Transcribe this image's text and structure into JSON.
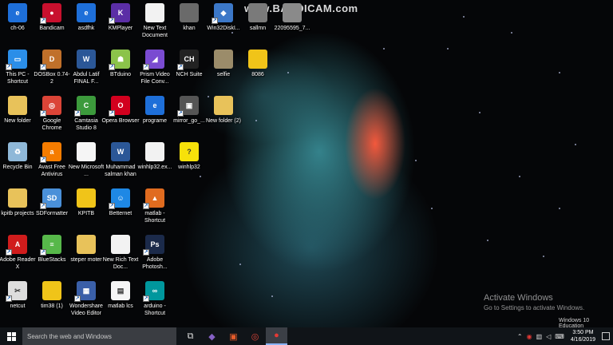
{
  "watermark": "www.BANDICAM.com",
  "desktop_icons": [
    {
      "label": "ch-06",
      "icon": "pdf-edge-icon",
      "color": "#1e6fd9",
      "glyph": "e",
      "col": 0,
      "row": 0
    },
    {
      "label": "Bandicam",
      "icon": "bandicam-icon",
      "color": "#c8102e",
      "glyph": "●",
      "col": 1,
      "row": 0
    },
    {
      "label": "asdfhk",
      "icon": "pdf-edge-icon",
      "color": "#1e6fd9",
      "glyph": "e",
      "col": 2,
      "row": 0
    },
    {
      "label": "KMPlayer",
      "icon": "kmplayer-icon",
      "color": "#5b2ea6",
      "glyph": "K",
      "col": 3,
      "row": 0
    },
    {
      "label": "New Text Document",
      "icon": "text-document-icon",
      "color": "#f2f2f2",
      "glyph": "",
      "col": 4,
      "row": 0
    },
    {
      "label": "khan",
      "icon": "image-file-icon",
      "color": "#6a6a6a",
      "glyph": "",
      "col": 5,
      "row": 0
    },
    {
      "label": "Win32DiskI...",
      "icon": "win32disk-icon",
      "color": "#3c78c8",
      "glyph": "◆",
      "col": 6,
      "row": 0
    },
    {
      "label": "sallmn",
      "icon": "image-file-icon",
      "color": "#7a7a7a",
      "glyph": "",
      "col": 7,
      "row": 0
    },
    {
      "label": "22095595_7...",
      "icon": "image-file-icon",
      "color": "#8a8a8a",
      "glyph": "",
      "col": 8,
      "row": 0
    },
    {
      "label": "This PC - Shortcut",
      "icon": "this-pc-icon",
      "color": "#2b8ee8",
      "glyph": "▭",
      "col": 0,
      "row": 1
    },
    {
      "label": "DOSBox 0.74-2",
      "icon": "dosbox-icon",
      "color": "#c0702a",
      "glyph": "D",
      "col": 1,
      "row": 1
    },
    {
      "label": "Abdul Latif FINAL F...",
      "icon": "word-document-icon",
      "color": "#2b5797",
      "glyph": "W",
      "col": 2,
      "row": 1
    },
    {
      "label": "BTduino",
      "icon": "btduino-icon",
      "color": "#8bc34a",
      "glyph": "☗",
      "col": 3,
      "row": 1
    },
    {
      "label": "Prism Video File Conv...",
      "icon": "prism-video-icon",
      "color": "#7a4bd1",
      "glyph": "◢",
      "col": 4,
      "row": 1
    },
    {
      "label": "NCH Suite",
      "icon": "nch-suite-icon",
      "color": "#222222",
      "glyph": "CH",
      "col": 5,
      "row": 1
    },
    {
      "label": "selfie",
      "icon": "image-file-icon",
      "color": "#9b8c6a",
      "glyph": "",
      "col": 6,
      "row": 1
    },
    {
      "label": "8086",
      "icon": "zip-folder-icon",
      "color": "#f0c419",
      "glyph": "",
      "col": 7,
      "row": 1
    },
    {
      "label": "New folder",
      "icon": "folder-icon",
      "color": "#e8c25a",
      "glyph": "",
      "col": 0,
      "row": 2
    },
    {
      "label": "Google Chrome",
      "icon": "chrome-icon",
      "color": "#db4437",
      "glyph": "◎",
      "col": 1,
      "row": 2
    },
    {
      "label": "Camtasia Studio 8",
      "icon": "camtasia-icon",
      "color": "#3c9a3c",
      "glyph": "C",
      "col": 2,
      "row": 2
    },
    {
      "label": "Opera Browser",
      "icon": "opera-icon",
      "color": "#d2001e",
      "glyph": "O",
      "col": 3,
      "row": 2
    },
    {
      "label": "programe",
      "icon": "pdf-edge-icon",
      "color": "#1e6fd9",
      "glyph": "e",
      "col": 4,
      "row": 2
    },
    {
      "label": "mirror_go_...",
      "icon": "mirror-go-icon",
      "color": "#555555",
      "glyph": "▣",
      "col": 5,
      "row": 2
    },
    {
      "label": "New folder (2)",
      "icon": "folder-icon",
      "color": "#e8c25a",
      "glyph": "",
      "col": 6,
      "row": 2
    },
    {
      "label": "Recycle Bin",
      "icon": "recycle-bin-icon",
      "color": "#8fb8d8",
      "glyph": "♻",
      "col": 0,
      "row": 3
    },
    {
      "label": "Avast Free Antivirus",
      "icon": "avast-icon",
      "color": "#f57c00",
      "glyph": "a",
      "col": 1,
      "row": 3
    },
    {
      "label": "New Microsoft ...",
      "icon": "blank-document-icon",
      "color": "#f5f5f5",
      "glyph": "",
      "col": 2,
      "row": 3
    },
    {
      "label": "Muhammad salman khan",
      "icon": "word-document-icon",
      "color": "#2b5797",
      "glyph": "W",
      "col": 3,
      "row": 3
    },
    {
      "label": "winhlp32.ex...",
      "icon": "text-document-icon",
      "color": "#f2f2f2",
      "glyph": "",
      "col": 4,
      "row": 3
    },
    {
      "label": "winhlp32",
      "icon": "help-icon",
      "color": "#f7e10a",
      "glyph": "?",
      "col": 5,
      "row": 3
    },
    {
      "label": "kpitb projects",
      "icon": "folder-icon",
      "color": "#e8c25a",
      "glyph": "",
      "col": 0,
      "row": 4
    },
    {
      "label": "SDFormatter",
      "icon": "sdformatter-icon",
      "color": "#4a90d9",
      "glyph": "SD",
      "col": 1,
      "row": 4
    },
    {
      "label": "KPITB",
      "icon": "zip-folder-icon",
      "color": "#f0c419",
      "glyph": "",
      "col": 2,
      "row": 4
    },
    {
      "label": "Betternet",
      "icon": "betternet-icon",
      "color": "#1e88e5",
      "glyph": "☺",
      "col": 3,
      "row": 4
    },
    {
      "label": "matlab - Shortcut",
      "icon": "matlab-icon",
      "color": "#e06b1f",
      "glyph": "▲",
      "col": 4,
      "row": 4
    },
    {
      "label": "Adobe Reader X",
      "icon": "adobe-reader-icon",
      "color": "#d01c1c",
      "glyph": "A",
      "col": 0,
      "row": 5
    },
    {
      "label": "BlueStacks",
      "icon": "bluestacks-icon",
      "color": "#57b84a",
      "glyph": "≡",
      "col": 1,
      "row": 5
    },
    {
      "label": "steper moter",
      "icon": "folder-icon",
      "color": "#e8c25a",
      "glyph": "",
      "col": 2,
      "row": 5
    },
    {
      "label": "New Rich Text Doc...",
      "icon": "rich-text-document-icon",
      "color": "#f2f2f2",
      "glyph": "",
      "col": 3,
      "row": 5
    },
    {
      "label": "Adobe Photosh...",
      "icon": "photoshop-icon",
      "color": "#1b2a4a",
      "glyph": "Ps",
      "col": 4,
      "row": 5
    },
    {
      "label": "netcut",
      "icon": "netcut-icon",
      "color": "#dddddd",
      "glyph": "✂",
      "col": 0,
      "row": 6
    },
    {
      "label": "tim38 (1)",
      "icon": "zip-folder-icon",
      "color": "#f0c419",
      "glyph": "",
      "col": 1,
      "row": 6
    },
    {
      "label": "Wondershare Video Editor",
      "icon": "wondershare-icon",
      "color": "#3a5fa8",
      "glyph": "▦",
      "col": 2,
      "row": 6
    },
    {
      "label": "matlab lcs",
      "icon": "spreadsheet-icon",
      "color": "#f5f5f5",
      "glyph": "▤",
      "col": 3,
      "row": 6
    },
    {
      "label": "arduino - Shortcut",
      "icon": "arduino-icon",
      "color": "#00979d",
      "glyph": "∞",
      "col": 4,
      "row": 6
    }
  ],
  "activation": {
    "title": "Activate Windows",
    "subtitle": "Go to Settings to activate Windows."
  },
  "edition": "Windows 10 Education",
  "taskbar": {
    "search_placeholder": "Search the web and Windows",
    "pinned": [
      {
        "name": "task-view-button",
        "icon": "task-view-icon",
        "glyph": "⧉",
        "active": false
      },
      {
        "name": "visual-studio-button",
        "icon": "visual-studio-icon",
        "glyph": "◆",
        "active": false
      },
      {
        "name": "office-button",
        "icon": "office-icon",
        "glyph": "▣",
        "active": false
      },
      {
        "name": "chrome-button",
        "icon": "chrome-icon",
        "glyph": "◎",
        "active": false
      },
      {
        "name": "bandicam-button",
        "icon": "bandicam-icon",
        "glyph": "●",
        "active": true
      }
    ],
    "tray_icons": [
      "chevron-up-icon",
      "record-icon",
      "network-icon",
      "volume-icon",
      "keyboard-icon"
    ],
    "time": "3:50 PM",
    "date": "4/16/2019"
  }
}
